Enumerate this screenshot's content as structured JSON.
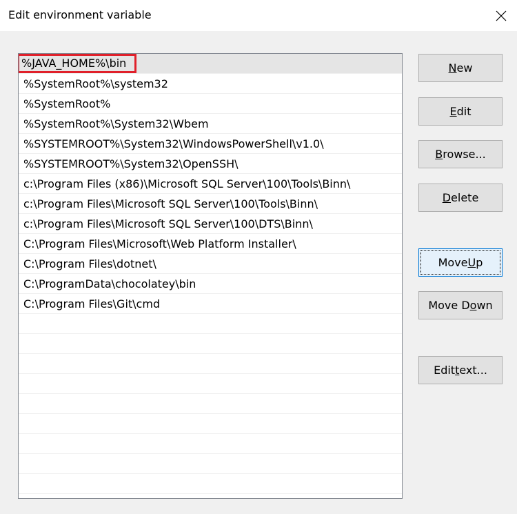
{
  "window": {
    "title": "Edit environment variable"
  },
  "list": {
    "items": [
      "%JAVA_HOME%\\bin",
      "%SystemRoot%\\system32",
      "%SystemRoot%",
      "%SystemRoot%\\System32\\Wbem",
      "%SYSTEMROOT%\\System32\\WindowsPowerShell\\v1.0\\",
      "%SYSTEMROOT%\\System32\\OpenSSH\\",
      "c:\\Program Files (x86)\\Microsoft SQL Server\\100\\Tools\\Binn\\",
      "c:\\Program Files\\Microsoft SQL Server\\100\\Tools\\Binn\\",
      "c:\\Program Files\\Microsoft SQL Server\\100\\DTS\\Binn\\",
      "C:\\Program Files\\Microsoft\\Web Platform Installer\\",
      "C:\\Program Files\\dotnet\\",
      "C:\\ProgramData\\chocolatey\\bin",
      "C:\\Program Files\\Git\\cmd"
    ],
    "selected_index": 0
  },
  "buttons": {
    "new": {
      "before": "",
      "mnemonic": "N",
      "after": "ew"
    },
    "edit": {
      "before": "",
      "mnemonic": "E",
      "after": "dit"
    },
    "browse": {
      "before": "",
      "mnemonic": "B",
      "after": "rowse..."
    },
    "delete": {
      "before": "",
      "mnemonic": "D",
      "after": "elete"
    },
    "move_up": {
      "before": "Move ",
      "mnemonic": "U",
      "after": "p"
    },
    "move_down": {
      "before": "Move D",
      "mnemonic": "o",
      "after": "wn"
    },
    "edit_text": {
      "before": "Edit ",
      "mnemonic": "t",
      "after": "ext..."
    }
  },
  "colors": {
    "highlight_border": "#e0202a",
    "selected_row": "#e5e5e5",
    "focus_border": "#0078d7"
  }
}
